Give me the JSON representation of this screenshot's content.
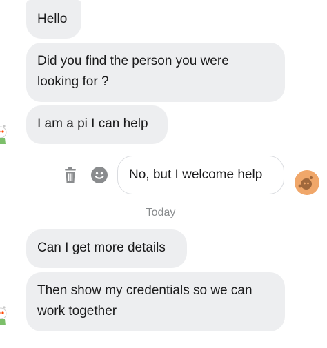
{
  "messages": [
    {
      "text": "Hello"
    },
    {
      "line1": "Did you find the person you were",
      "line2": "looking for ?"
    },
    {
      "text": "I am a pi I can help"
    },
    {
      "text": "No, but I welcome help"
    },
    {
      "text": "Can I get more details"
    },
    {
      "line1": "Then show my credentials so we can",
      "line2": "work together"
    }
  ],
  "date_separator": "Today",
  "icons": {
    "delete": "trash-icon",
    "react": "emoji-icon"
  },
  "colors": {
    "incoming_bubble": "#edeef0",
    "outgoing_bubble": "#ffffff",
    "icon_gray": "#8a8c8e",
    "avatar_orange": "#f0a76a"
  }
}
